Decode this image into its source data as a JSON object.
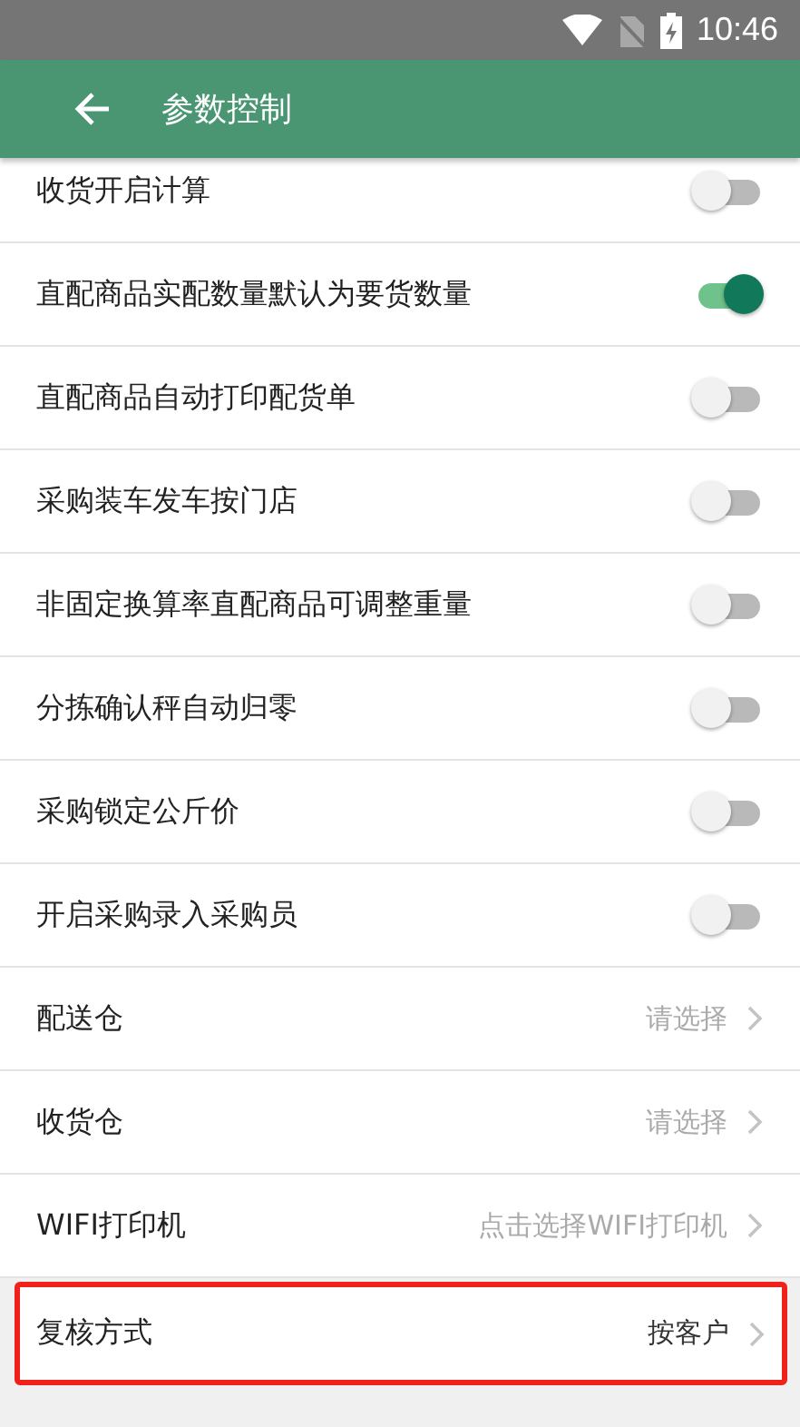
{
  "status_bar": {
    "time": "10:46"
  },
  "app_bar": {
    "title": "参数控制"
  },
  "settings": [
    {
      "kind": "toggle",
      "label": "收货开启计算",
      "on": false,
      "highlighted": false
    },
    {
      "kind": "toggle",
      "label": "直配商品实配数量默认为要货数量",
      "on": true,
      "highlighted": false
    },
    {
      "kind": "toggle",
      "label": "直配商品自动打印配货单",
      "on": false,
      "highlighted": false
    },
    {
      "kind": "toggle",
      "label": "采购装车发车按门店",
      "on": false,
      "highlighted": false
    },
    {
      "kind": "toggle",
      "label": "非固定换算率直配商品可调整重量",
      "on": false,
      "highlighted": false
    },
    {
      "kind": "toggle",
      "label": "分拣确认秤自动归零",
      "on": false,
      "highlighted": false
    },
    {
      "kind": "toggle",
      "label": "采购锁定公斤价",
      "on": false,
      "highlighted": false
    },
    {
      "kind": "toggle",
      "label": "开启采购录入采购员",
      "on": false,
      "highlighted": false
    },
    {
      "kind": "select",
      "label": "配送仓",
      "placeholder": "请选择",
      "highlighted": false
    },
    {
      "kind": "select",
      "label": "收货仓",
      "placeholder": "请选择",
      "highlighted": false
    },
    {
      "kind": "select",
      "label": "WIFI打印机",
      "placeholder": "点击选择WIFI打印机",
      "highlighted": false
    },
    {
      "kind": "select",
      "label": "复核方式",
      "value": "按客户",
      "highlighted": true
    }
  ]
}
